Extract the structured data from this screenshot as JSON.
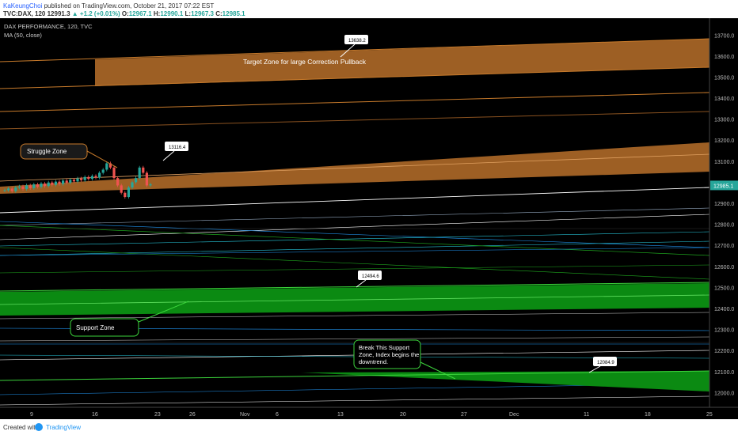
{
  "header": {
    "author": "KaKeungChoi",
    "published": "published on TradingView.com, October 21, 2017 07:22 EST",
    "symbol": "TVC:DAX, 120",
    "last": "12991.3",
    "change": "+1.2 (+0.01%)",
    "open_label": "O:",
    "open": "12967.1",
    "high_label": "H:",
    "high": "12990.1",
    "low_label": "L:",
    "low": "12967.3",
    "close_label": "C:",
    "close": "12985.1"
  },
  "legend": {
    "series": "DAX PERFORMANCE, 120, TVC",
    "indicator": "MA (50, close)"
  },
  "annotations": {
    "target_zone": "Target Zone for large Correction Pullback",
    "struggle_zone": "Struggle Zone",
    "support_zone": "Support Zone",
    "break_support": [
      "Break This Support",
      "Zone, Index begins the",
      "downtrend."
    ],
    "callout_13638": "13638.2",
    "callout_13116": "13116.4",
    "callout_12494": "12494.6",
    "callout_12084": "12084.9"
  },
  "footer": {
    "created": "Created with",
    "brand": "TradingView"
  },
  "colors": {
    "background": "#000000",
    "orange": "#c77a2b",
    "green": "#0b8a12",
    "price_tag": "#26a69a"
  },
  "chart_data": {
    "type": "line",
    "ylim": [
      11930,
      13780
    ],
    "y_ticks": [
      12000,
      12100,
      12200,
      12300,
      12400,
      12500,
      12600,
      12700,
      12800,
      12900,
      13000,
      13100,
      13200,
      13300,
      13400,
      13500,
      13600,
      13700
    ],
    "x_ticks": [
      "9",
      "16",
      "23",
      "26",
      "Nov",
      "6",
      "13",
      "20",
      "27",
      "Dec",
      "11",
      "18",
      "25"
    ],
    "last_price_label": "12985.1",
    "last_price": 12985.1,
    "candles": [
      12962,
      12970,
      12958,
      12975,
      12980,
      12968,
      12985,
      12972,
      12990,
      12978,
      12994,
      12982,
      12999,
      12988,
      13003,
      12992,
      13008,
      12998,
      13012,
      13004,
      13018,
      13010,
      13025,
      13016,
      13030,
      13022,
      13045,
      13060,
      13090,
      13070,
      13020,
      12985,
      12950,
      12930,
      12975,
      13000,
      13020,
      13070,
      13045,
      12985,
      12990
    ]
  }
}
